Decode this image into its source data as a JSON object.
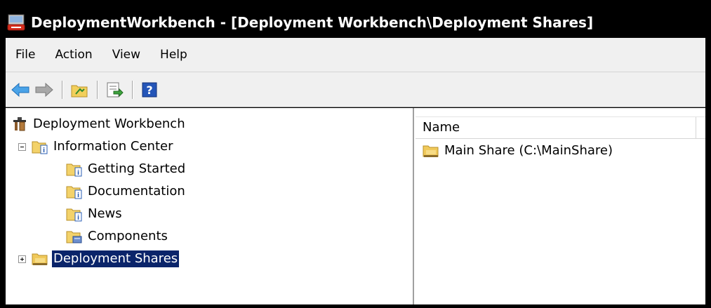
{
  "window": {
    "title": "DeploymentWorkbench - [Deployment Workbench\\Deployment Shares]"
  },
  "menubar": {
    "items": [
      "File",
      "Action",
      "View",
      "Help"
    ]
  },
  "toolbar": {
    "buttons": [
      "back-arrow-icon",
      "forward-arrow-icon",
      "up-folder-icon",
      "export-list-icon",
      "help-icon"
    ]
  },
  "tree": {
    "root": "Deployment Workbench",
    "items": [
      {
        "label": "Information Center",
        "expanded": true
      },
      {
        "label": "Getting Started"
      },
      {
        "label": "Documentation"
      },
      {
        "label": "News"
      },
      {
        "label": "Components"
      },
      {
        "label": "Deployment Shares",
        "expanded": false,
        "selected": true
      }
    ]
  },
  "list": {
    "columns": [
      "Name"
    ],
    "rows": [
      {
        "name": "Main Share (C:\\MainShare)"
      }
    ]
  },
  "colors": {
    "titlebar_text": "#ffffff",
    "selection_bg": "#0a246a",
    "chrome_bg": "#f0f0f0"
  }
}
